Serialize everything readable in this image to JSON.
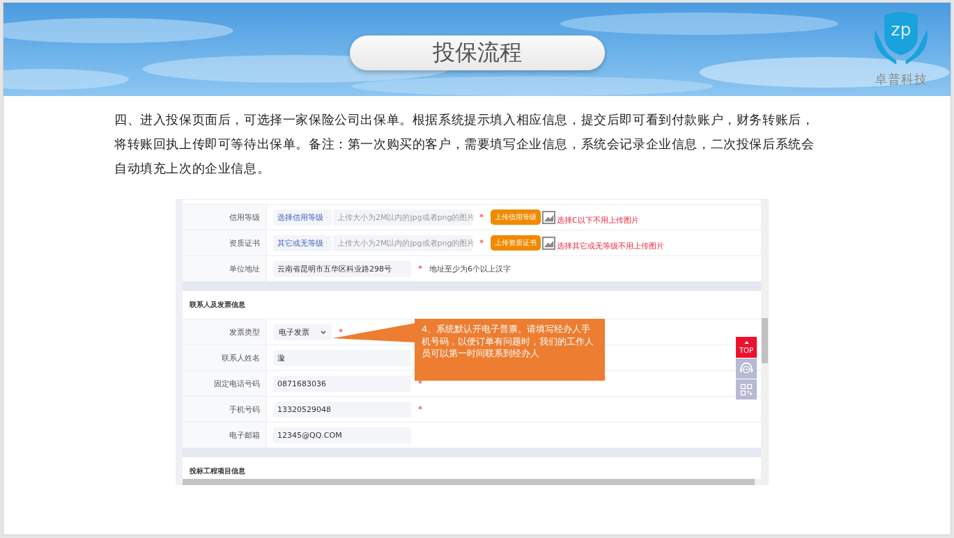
{
  "title": "投保流程",
  "logo": {
    "mark": "zp",
    "name": "卓普科技"
  },
  "paragraph": "四、进入投保页面后，可选择一家保险公司出保单。根据系统提示填入相应信息，提交后即可看到付款账户，财务转账后，将转账回执上传即可等待出保单。备注：第一次购买的客户，需要填写企业信息，系统会记录企业信息，二次投保后系统会自动填充上次的企业信息。",
  "form": {
    "top_rows": [
      {
        "kind": "upload",
        "label": "信用等级",
        "select": "选择信用等级",
        "placeholder": "上传大小为2M以内的jpg或者png的图片",
        "required_mark": "*",
        "button": "上传信用等级",
        "hint": "选择C以下不用上传图片"
      },
      {
        "kind": "upload",
        "label": "资质证书",
        "select": "其它或无等级",
        "placeholder": "上传大小为2M以内的jpg或者png的图片",
        "required_mark": "*",
        "button": "上传资质证书",
        "hint": "选择其它或无等级不用上传图片"
      },
      {
        "kind": "text",
        "label": "单位地址",
        "value": "云南省昆明市五华区科业路298号",
        "required_mark": "*",
        "hint": "地址至少为6个以上汉字"
      }
    ],
    "sections": [
      {
        "title": "联系人及发票信息",
        "rows": [
          {
            "kind": "select",
            "label": "发票类型",
            "value": "电子发票",
            "required_mark": "*"
          },
          {
            "kind": "text",
            "label": "联系人姓名",
            "value": "漩"
          },
          {
            "kind": "text",
            "label": "固定电话号码",
            "value": "0871683036",
            "required_mark": "*"
          },
          {
            "kind": "text",
            "label": "手机号码",
            "value": "13320529048",
            "required_mark": "*"
          },
          {
            "kind": "text",
            "label": "电子邮箱",
            "value": "12345@QQ.COM"
          }
        ]
      },
      {
        "title": "投标工程项目信息"
      }
    ],
    "callout": "4、系统默认开电子普票。请填写经办人手机号码，以便订单有问题时，我们的工作人员可以第一时间联系到经办人",
    "float_top": "TOP"
  }
}
